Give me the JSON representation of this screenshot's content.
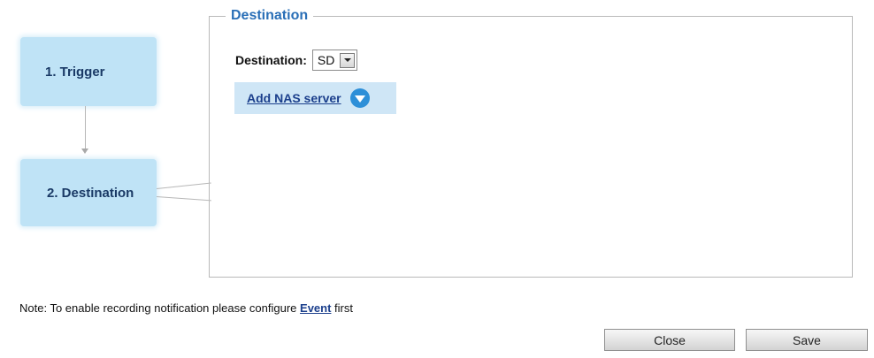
{
  "steps": [
    {
      "label": "1. Trigger"
    },
    {
      "label": "2. Destination"
    }
  ],
  "panel": {
    "legend": "Destination",
    "destination_label": "Destination:",
    "destination_value": "SD",
    "add_nas_label": "Add NAS server"
  },
  "note": {
    "prefix": "Note: To enable recording notification please configure ",
    "link": "Event",
    "suffix": " first"
  },
  "buttons": {
    "close": "Close",
    "save": "Save"
  },
  "icons": [
    "select-arrow-icon",
    "expand-circle-icon"
  ]
}
